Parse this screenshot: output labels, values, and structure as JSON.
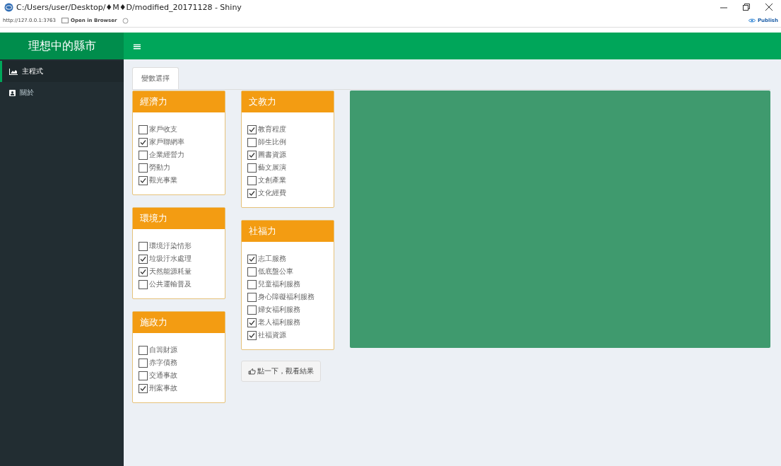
{
  "window": {
    "title": "C:/Users/user/Desktop/♦M♦D/modified_20171128 - Shiny"
  },
  "toolbar": {
    "address": "http://127.0.0.1:3763",
    "open_button": "Open in Browser",
    "publish_button": "Publish"
  },
  "header": {
    "brand": "理想中的縣市",
    "menu_toggle": "≡"
  },
  "sidebar": {
    "items": [
      {
        "label": "主程式",
        "kind": "chart",
        "selected": true
      },
      {
        "label": "關於",
        "kind": "user",
        "selected": false
      }
    ]
  },
  "tabs": [
    {
      "label": "變數選擇",
      "selected": true
    }
  ],
  "columns": [
    {
      "boxes": [
        {
          "title": "經濟力",
          "options": [
            {
              "label": "家戶收支",
              "checked": false
            },
            {
              "label": "家戶聯網率",
              "checked": true
            },
            {
              "label": "企業經營力",
              "checked": false
            },
            {
              "label": "勞動力",
              "checked": false
            },
            {
              "label": "觀光事業",
              "checked": true
            }
          ]
        },
        {
          "title": "環境力",
          "options": [
            {
              "label": "環境汙染情形",
              "checked": false
            },
            {
              "label": "垃圾汙水處理",
              "checked": true
            },
            {
              "label": "天然能源耗量",
              "checked": true
            },
            {
              "label": "公共運輸普及",
              "checked": false
            }
          ]
        },
        {
          "title": "施政力",
          "options": [
            {
              "label": "自籌財源",
              "checked": false
            },
            {
              "label": "赤字債務",
              "checked": false
            },
            {
              "label": "交通事故",
              "checked": false
            },
            {
              "label": "刑案事故",
              "checked": true
            }
          ]
        }
      ]
    },
    {
      "boxes": [
        {
          "title": "文教力",
          "options": [
            {
              "label": "教育程度",
              "checked": true
            },
            {
              "label": "師生比例",
              "checked": false
            },
            {
              "label": "圖書資源",
              "checked": true
            },
            {
              "label": "藝文展演",
              "checked": false
            },
            {
              "label": "文創產業",
              "checked": false
            },
            {
              "label": "文化經費",
              "checked": true
            }
          ]
        },
        {
          "title": "社福力",
          "options": [
            {
              "label": "志工服務",
              "checked": true
            },
            {
              "label": "低底盤公車",
              "checked": false
            },
            {
              "label": "兒童福利服務",
              "checked": false
            },
            {
              "label": "身心障礙福利服務",
              "checked": false
            },
            {
              "label": "婦女福利服務",
              "checked": false
            },
            {
              "label": "老人福利服務",
              "checked": true
            },
            {
              "label": "社福資源",
              "checked": true
            }
          ]
        }
      ],
      "action_button": "點一下，觀看結果"
    }
  ]
}
